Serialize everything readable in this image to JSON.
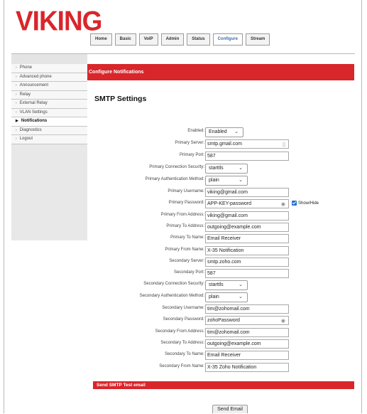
{
  "brand": {
    "logo_text": "VIKING",
    "color": "#d8262b"
  },
  "tabs": [
    {
      "label": "Home"
    },
    {
      "label": "Basic"
    },
    {
      "label": "VoIP"
    },
    {
      "label": "Admin"
    },
    {
      "label": "Status"
    },
    {
      "label": "Configure",
      "active": true
    },
    {
      "label": "Stream"
    }
  ],
  "sidebar": {
    "items": [
      {
        "label": "Phone"
      },
      {
        "label": "Advanced phone"
      },
      {
        "label": "Announcement"
      },
      {
        "label": "Relay"
      },
      {
        "label": "External Relay"
      },
      {
        "label": "VLAN Settings"
      },
      {
        "label": "Notifications",
        "active": true
      },
      {
        "label": "Diagnostics"
      },
      {
        "label": "Logout"
      }
    ]
  },
  "header": {
    "title": "Configure Notifications"
  },
  "smtp": {
    "title": "SMTP Settings",
    "enabled": {
      "label": "Enabled:",
      "value": "Enabled"
    },
    "primary_server": {
      "label": "Primary Server:",
      "value": "smtp.gmail.com"
    },
    "primary_port": {
      "label": "Primary Port:",
      "value": "587"
    },
    "primary_security": {
      "label": "Primary Connection Security:",
      "value": "starttls"
    },
    "primary_auth": {
      "label": "Primary Authentication Method:",
      "value": "plain"
    },
    "primary_username": {
      "label": "Primary Username:",
      "value": "viking@gmail.com"
    },
    "primary_password": {
      "label": "Primary Password:",
      "value": "APP-KEY-password",
      "show_hide": "Show/Hide"
    },
    "primary_from_address": {
      "label": "Primary From Address:",
      "value": "viking@gmail.com"
    },
    "primary_to_address": {
      "label": "Primary To Address:",
      "value": "outgoing@example.com"
    },
    "primary_to_name": {
      "label": "Primary To Name:",
      "value": "Email Receiver"
    },
    "primary_from_name": {
      "label": "Primary From Name:",
      "value": "X-35 Notification"
    },
    "secondary_server": {
      "label": "Secondary Server:",
      "value": "smtp.zoho.com"
    },
    "secondary_port": {
      "label": "Secondary Port:",
      "value": "587"
    },
    "secondary_security": {
      "label": "Secondary Connection Security:",
      "value": "starttls"
    },
    "secondary_auth": {
      "label": "Secondary Authentication Method:",
      "value": "plain"
    },
    "secondary_username": {
      "label": "Secondary Username:",
      "value": "tim@zohomail.com"
    },
    "secondary_password": {
      "label": "Secondary Password:",
      "value": "zohoPassword"
    },
    "secondary_from_address": {
      "label": "Secondary From Address:",
      "value": "tim@zohomail.com"
    },
    "secondary_to_address": {
      "label": "Secondary To Address:",
      "value": "outgoing@example.com"
    },
    "secondary_to_name": {
      "label": "Secondary To Name:",
      "value": "Email Receiver"
    },
    "secondary_from_name": {
      "label": "Secondary From Name:",
      "value": "X-35 Zoho Notification"
    }
  },
  "test": {
    "title": "Send SMTP Test email",
    "button": "Send Email"
  }
}
